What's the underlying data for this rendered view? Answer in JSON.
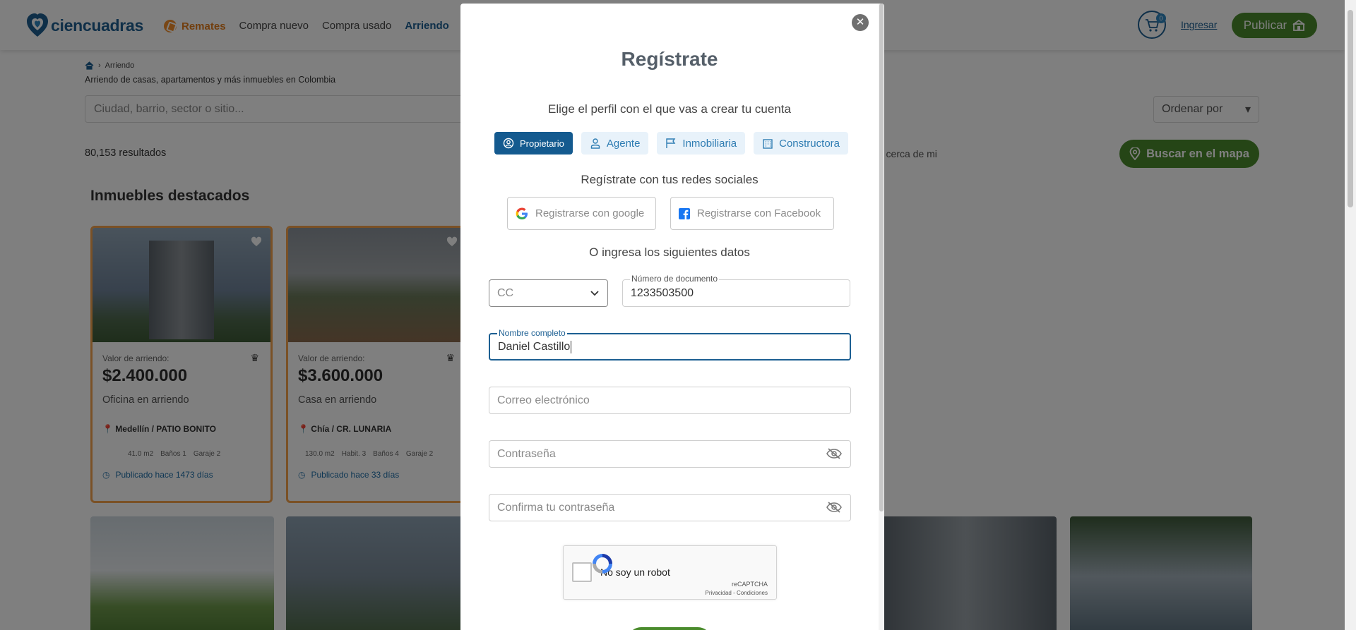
{
  "header": {
    "logo_text": "ciencuadras",
    "nav": [
      "Remates",
      "Compra nuevo",
      "Compra usado",
      "Arriendo"
    ],
    "cart_count": "0",
    "login_label": "Ingresar",
    "publish_label": "Publicar"
  },
  "page": {
    "breadcrumb": "Arriendo",
    "subtitle": "Arriendo de casas, apartamentos y más inmuebles en Colombia",
    "search_placeholder": "Ciudad, barrio, sector o sitio...",
    "order_label": "Ordenar por",
    "results": "80,153 resultados",
    "near_me": "r cerca de mi",
    "map_button": "Buscar en el mapa",
    "featured_title": "Inmuebles destacados"
  },
  "cards": [
    {
      "label": "Valor de arriendo:",
      "price": "$2.400.000",
      "type": "Oficina en arriendo",
      "location": "Medellín / PATIO BONITO",
      "features": [
        "41.0 m2",
        "Baños 1",
        "Garaje 2"
      ],
      "published": "Publicado hace 1473 días"
    },
    {
      "label": "Valor de arriendo:",
      "price": "$3.600.000",
      "type": "Casa en arriendo",
      "location": "Chía / CR. LUNARIA",
      "features": [
        "130.0 m2",
        "Habit. 3",
        "Baños 4",
        "Garaje 2"
      ],
      "published": "Publicado hace 33 días"
    }
  ],
  "modal": {
    "title": "Regístrate",
    "profile_prompt": "Elige el perfil con el que vas a crear tu cuenta",
    "profiles": [
      "Propietario",
      "Agente",
      "Inmobiliaria",
      "Constructora"
    ],
    "social_prompt": "Regístrate con tus redes sociales",
    "google_label": "Registrarse con google",
    "facebook_label": "Registrarse con Facebook",
    "data_prompt": "O ingresa los siguientes datos",
    "doc_type": "CC",
    "doc_number_label": "Número de documento",
    "doc_number": "1233503500",
    "full_name_label": "Nombre completo",
    "full_name": "Daniel Castillo",
    "email_placeholder": "Correo electrónico",
    "password_placeholder": "Contraseña",
    "confirm_placeholder": "Confirma tu contraseña",
    "captcha_label": "No soy un robot",
    "captcha_brand": "reCAPTCHA",
    "captcha_terms": "Privacidad - Condiciones"
  },
  "colors": {
    "brand_blue": "#1c5f92",
    "brand_green": "#4a8b2c",
    "remates_orange": "#e37d1c"
  }
}
